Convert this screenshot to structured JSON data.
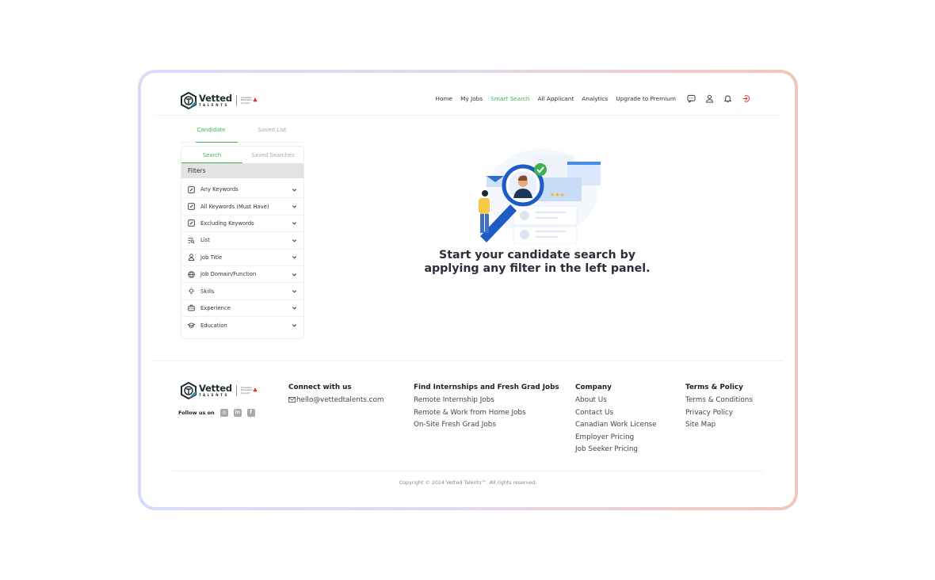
{
  "brand": {
    "name": "Vetted",
    "sub": "TALENTS",
    "tagline": "Canadian Education Council",
    "accent_color": "#3bb54a",
    "logout_color": "#e53935"
  },
  "nav": {
    "items": [
      {
        "label": "Home",
        "active": false
      },
      {
        "label": "My Jobs",
        "active": false
      },
      {
        "label": "Smart Search",
        "active": true
      },
      {
        "label": "All Applicant",
        "active": false
      },
      {
        "label": "Analytics",
        "active": false
      },
      {
        "label": "Upgrade to Premium",
        "active": false
      }
    ],
    "icons": [
      "chat-icon",
      "user-icon",
      "bell-icon",
      "logout-icon"
    ]
  },
  "left_panel": {
    "top_tabs": [
      {
        "label": "Candidate",
        "active": true
      },
      {
        "label": "Saved List",
        "active": false
      }
    ],
    "sub_tabs": [
      {
        "label": "Search",
        "active": true
      },
      {
        "label": "Saved Searches",
        "active": false
      }
    ],
    "filters_title": "Filters",
    "filters": [
      {
        "label": "Any Keywords",
        "icon": "keyword-icon"
      },
      {
        "label": "All Keywords (Must Have)",
        "icon": "keyword-icon"
      },
      {
        "label": "Excluding Keywords",
        "icon": "keyword-icon"
      },
      {
        "label": "List",
        "icon": "list-search-icon"
      },
      {
        "label": "Job Title",
        "icon": "user-icon"
      },
      {
        "label": "Job Domain/Function",
        "icon": "globe-icon"
      },
      {
        "label": "Skills",
        "icon": "lightbulb-icon"
      },
      {
        "label": "Experience",
        "icon": "briefcase-icon"
      },
      {
        "label": "Education",
        "icon": "graduation-cap-icon"
      }
    ]
  },
  "main": {
    "message_line1": "Start your candidate search by",
    "message_line2": "applying any filter in the left panel."
  },
  "footer": {
    "follow_label": "Follow us on",
    "social": [
      "instagram-icon",
      "linkedin-icon",
      "facebook-icon"
    ],
    "connect": {
      "title": "Connect with us",
      "email": "hello@vettedtalents.com"
    },
    "find": {
      "title": "Find Internships and Fresh Grad Jobs",
      "links": [
        "Remote Internship Jobs",
        "Remote & Work from Home Jobs",
        "On-Site Fresh Grad Jobs"
      ]
    },
    "company": {
      "title": "Company",
      "links": [
        "About Us",
        "Contact Us",
        "Canadian Work License",
        "Employer Pricing",
        "Job Seeker Pricing"
      ]
    },
    "terms": {
      "title": "Terms & Policy",
      "links": [
        "Terms & Conditions",
        "Privacy Policy",
        "Site Map"
      ]
    },
    "copyright": "Copyright © 2024 Vetted Talents™. All rights reserved."
  }
}
